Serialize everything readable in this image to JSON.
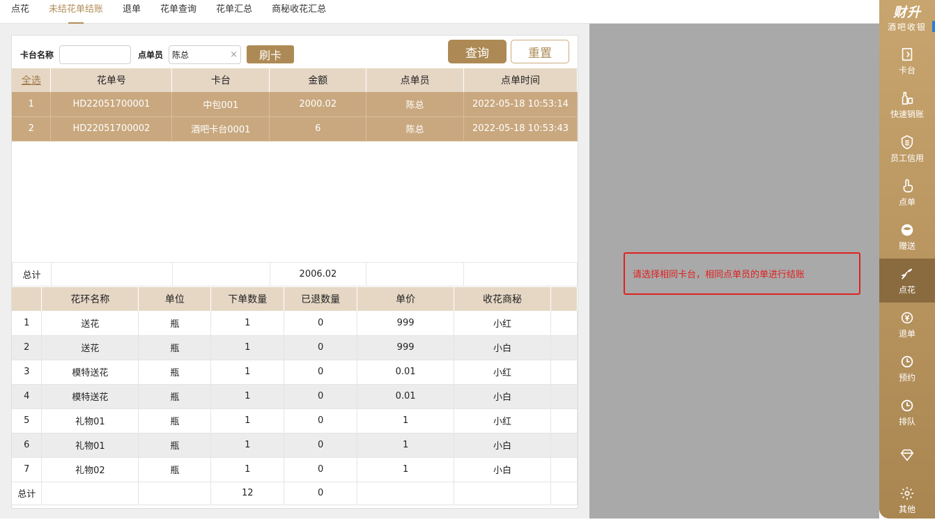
{
  "tabs": [
    "点花",
    "未结花单结账",
    "退单",
    "花单查询",
    "花单汇总",
    "商秘收花汇总"
  ],
  "active_tab": 1,
  "search": {
    "card_label": "卡台名称",
    "card_value": "",
    "waiter_label": "点单员",
    "waiter_value": "陈总",
    "swipe_label": "刷卡",
    "query_label": "查询",
    "reset_label": "重置"
  },
  "orders": {
    "headers": [
      "全选",
      "花单号",
      "卡台",
      "金额",
      "点单员",
      "点单时间"
    ],
    "rows": [
      [
        "1",
        "HD22051700001",
        "中包001",
        "2000.02",
        "陈总",
        "2022-05-18 10:53:14"
      ],
      [
        "2",
        "HD22051700002",
        "酒吧卡台0001",
        "6",
        "陈总",
        "2022-05-18 10:53:43"
      ]
    ],
    "total_label": "总计",
    "total_amount": "2006.02"
  },
  "items": {
    "headers": [
      "",
      "花环名称",
      "单位",
      "下单数量",
      "已退数量",
      "单价",
      "收花商秘",
      ""
    ],
    "rows": [
      [
        "1",
        "送花",
        "瓶",
        "1",
        "0",
        "999",
        "小红"
      ],
      [
        "2",
        "送花",
        "瓶",
        "1",
        "0",
        "999",
        "小白"
      ],
      [
        "3",
        "模特送花",
        "瓶",
        "1",
        "0",
        "0.01",
        "小红"
      ],
      [
        "4",
        "模特送花",
        "瓶",
        "1",
        "0",
        "0.01",
        "小白"
      ],
      [
        "5",
        "礼物01",
        "瓶",
        "1",
        "0",
        "1",
        "小红"
      ],
      [
        "6",
        "礼物01",
        "瓶",
        "1",
        "0",
        "1",
        "小白"
      ],
      [
        "7",
        "礼物02",
        "瓶",
        "1",
        "0",
        "1",
        "小白"
      ]
    ],
    "total_label": "总计",
    "total_qty": "12",
    "total_returned": "0"
  },
  "notice": "请选择相同卡台，相同点单员的单进行结账",
  "brand": {
    "name": "财升",
    "sub": "酒吧收银"
  },
  "sidebar": [
    {
      "label": "卡台",
      "icon": "door-icon"
    },
    {
      "label": "快速销账",
      "icon": "bottle-icon"
    },
    {
      "label": "员工信用",
      "icon": "credit-badge-icon"
    },
    {
      "label": "点单",
      "icon": "hand-pointer-icon"
    },
    {
      "label": "赠送",
      "icon": "gift-icon"
    },
    {
      "label": "点花",
      "icon": "flower-icon",
      "active": true
    },
    {
      "label": "退单",
      "icon": "refund-icon"
    },
    {
      "label": "预约",
      "icon": "clock-icon"
    },
    {
      "label": "排队",
      "icon": "queue-clock-icon"
    },
    {
      "label": "",
      "icon": "diamond-icon"
    },
    {
      "label": "其他",
      "icon": "gear-icon"
    }
  ],
  "colors": {
    "accent": "#ad8a55",
    "selected_row": "#c9a87f",
    "header": "#e6d7c5",
    "notice": "#e02020"
  }
}
